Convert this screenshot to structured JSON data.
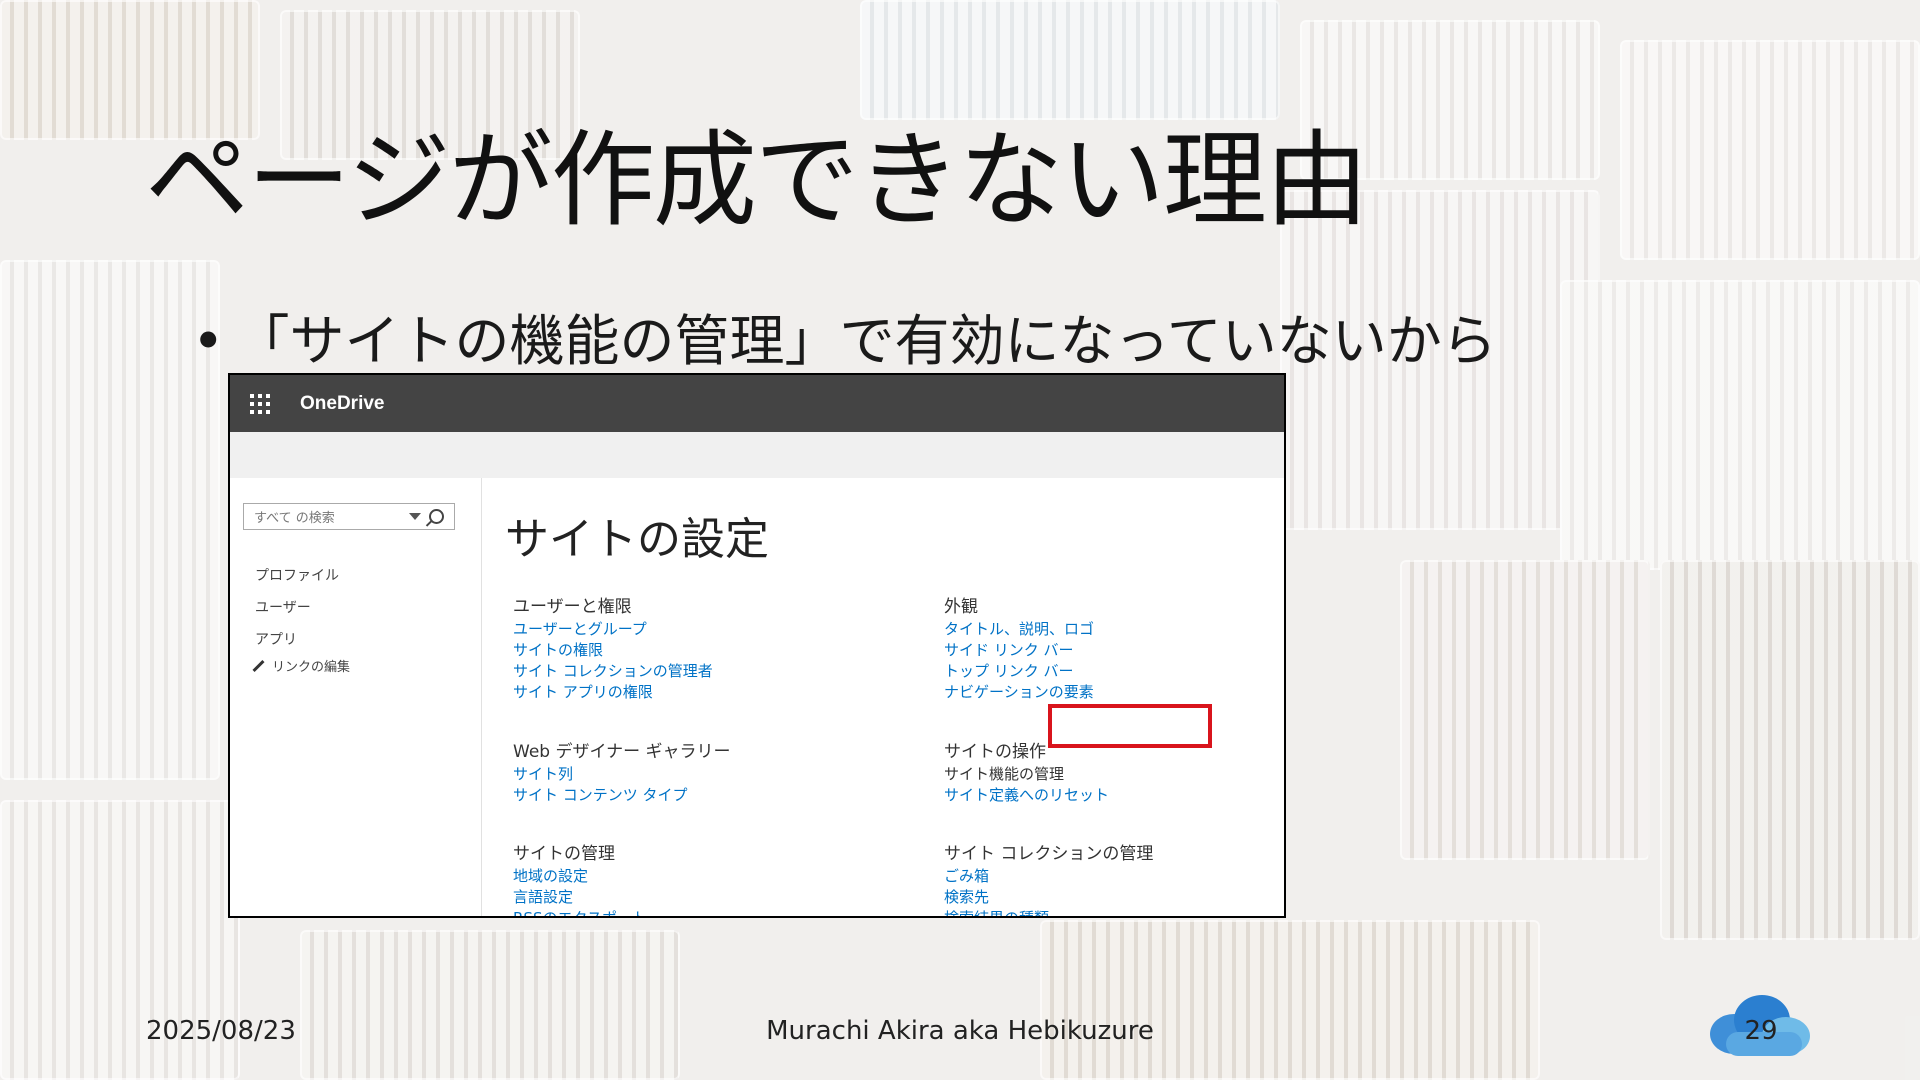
{
  "slide": {
    "title": "ページが作成できない理由",
    "bullet": "「サイトの機能の管理」で有効になっていないから",
    "footer": {
      "date": "2025/08/23",
      "author": "Murachi Akira aka Hebikuzure",
      "page_number": "29"
    }
  },
  "screenshot": {
    "suite_bar": {
      "brand": "OneDrive",
      "icon": "app-launcher-icon"
    },
    "search": {
      "placeholder": "すべて の検索"
    },
    "left_nav": {
      "items": [
        "プロファイル",
        "ユーザー",
        "アプリ"
      ],
      "edit_links": "リンクの編集"
    },
    "page_title": "サイトの設定",
    "groups": {
      "users": {
        "heading": "ユーザーと権限",
        "links": [
          "ユーザーとグループ",
          "サイトの権限",
          "サイト コレクションの管理者",
          "サイト アプリの権限"
        ]
      },
      "look": {
        "heading": "外観",
        "links": [
          "タイトル、説明、ロゴ",
          "サイド リンク バー",
          "トップ リンク バー",
          "ナビゲーションの要素"
        ]
      },
      "gallery": {
        "heading": "Web デザイナー ギャラリー",
        "links": [
          "サイト列",
          "サイト コンテンツ タイプ"
        ]
      },
      "actions": {
        "heading": "サイトの操作",
        "links": [
          "サイト機能の管理",
          "サイト定義へのリセット"
        ]
      },
      "admin": {
        "heading": "サイトの管理",
        "links": [
          "地域の設定",
          "言語設定",
          "RSSのエクスポート"
        ]
      },
      "collection": {
        "heading": "サイト コレクションの管理",
        "links": [
          "ごみ箱",
          "検索先",
          "検索結果の種類"
        ]
      }
    }
  }
}
